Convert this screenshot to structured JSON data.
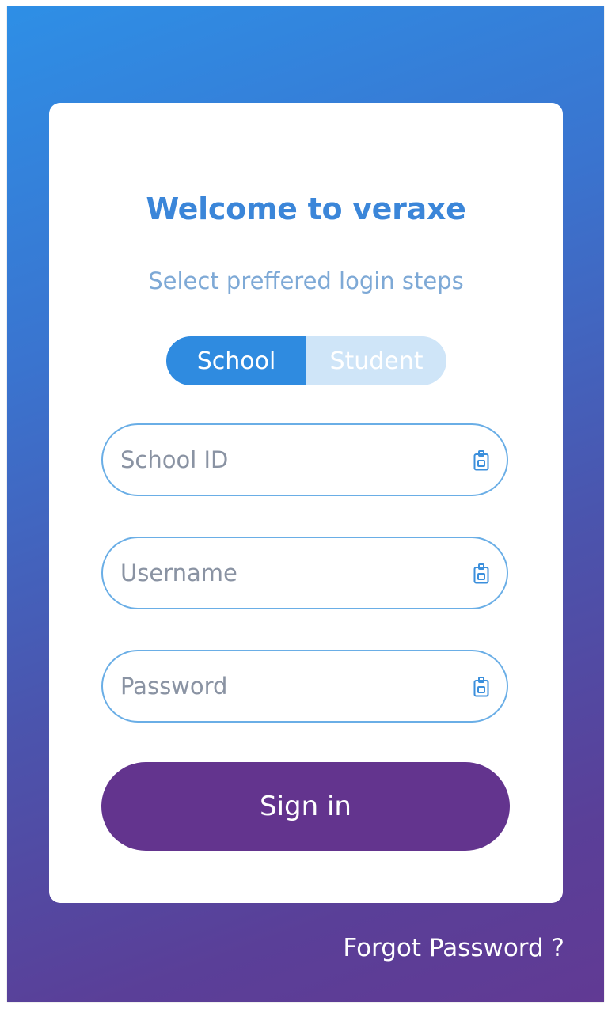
{
  "colors": {
    "accent": "#2f8be0",
    "title": "#3b86d9",
    "signin": "#63348e",
    "gradient_top": "#2e8fe6",
    "gradient_bottom": "#613a94"
  },
  "card": {
    "title": "Welcome to veraxe",
    "subtitle": "Select preffered login steps"
  },
  "toggle": {
    "options": [
      {
        "label": "School",
        "selected": true
      },
      {
        "label": "Student",
        "selected": false
      }
    ]
  },
  "fields": [
    {
      "placeholder": "School ID",
      "value": "",
      "icon": "id-badge-icon"
    },
    {
      "placeholder": "Username",
      "value": "",
      "icon": "id-badge-icon"
    },
    {
      "placeholder": "Password",
      "value": "",
      "icon": "id-badge-icon"
    }
  ],
  "signin_label": "Sign in",
  "forgot_label": "Forgot Password ?"
}
